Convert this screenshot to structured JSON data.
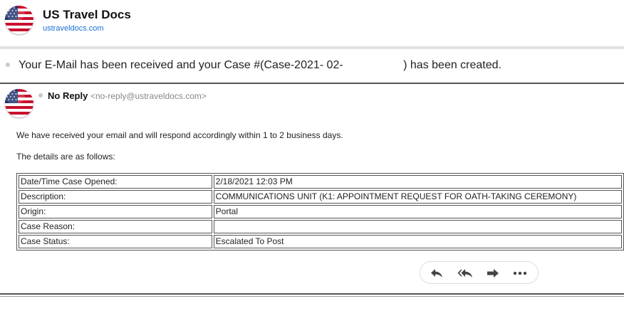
{
  "sender": {
    "name": "US Travel Docs",
    "domain": "ustraveldocs.com"
  },
  "subject": "Your E-Mail has been received and your Case #(Case-2021- 02-                   ) has been created.",
  "message": {
    "from_name": "No Reply",
    "from_email": "<no-reply@ustraveldocs.com>",
    "intro": "We have received your email and will respond accordingly within 1 to 2 business days.",
    "details_intro": "The details are as follows:",
    "details": [
      {
        "label": "Date/Time Case Opened:",
        "value": "2/18/2021 12:03 PM"
      },
      {
        "label": "Description:",
        "value": "COMMUNICATIONS UNIT (K1: APPOINTMENT REQUEST FOR OATH-TAKING CEREMONY)"
      },
      {
        "label": "Origin:",
        "value": "Portal"
      },
      {
        "label": "Case Reason:",
        "value": ""
      },
      {
        "label": "Case Status:",
        "value": "Escalated To Post"
      }
    ]
  },
  "actions": {
    "icons": [
      "reply-icon",
      "reply-all-icon",
      "forward-icon",
      "more-icon"
    ]
  },
  "colors": {
    "link": "#1a6fd6",
    "muted": "#888888",
    "flag_red": "#c8102e",
    "flag_blue": "#1b2f6b"
  }
}
